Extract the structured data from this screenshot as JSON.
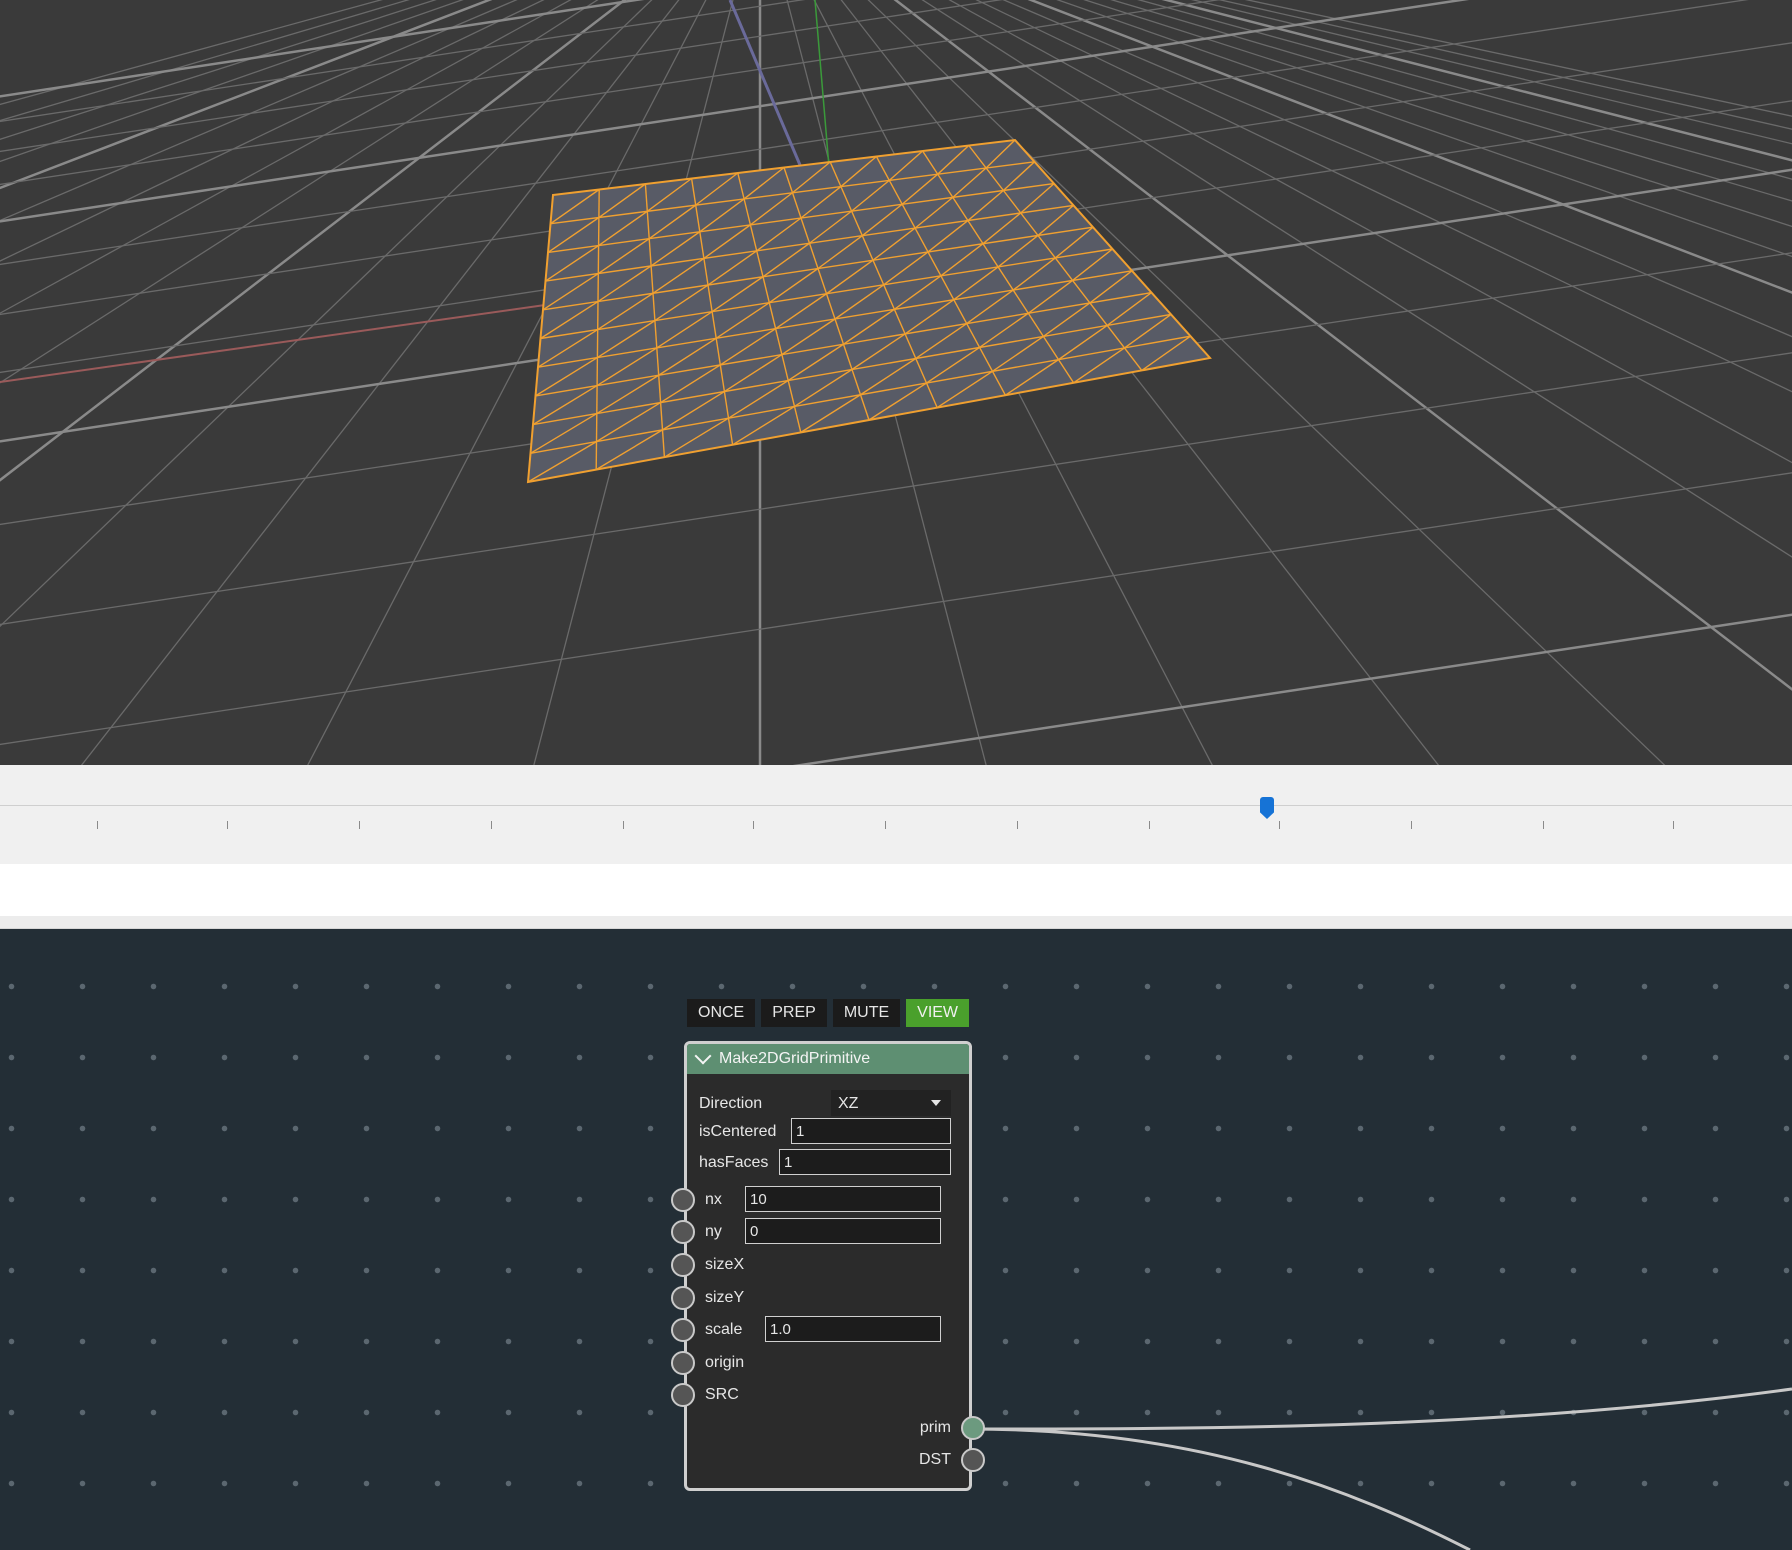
{
  "node": {
    "title": "Make2DGridPrimitive",
    "flags": [
      "ONCE",
      "PREP",
      "MUTE",
      "VIEW"
    ],
    "active_flag": "VIEW",
    "params": {
      "direction_label": "Direction",
      "direction_value": "XZ",
      "isCentered_label": "isCentered",
      "isCentered_value": "1",
      "hasFaces_label": "hasFaces",
      "hasFaces_value": "1"
    },
    "inputs": {
      "nx_label": "nx",
      "nx_value": "10",
      "ny_label": "ny",
      "ny_value": "0",
      "sizeX_label": "sizeX",
      "sizeY_label": "sizeY",
      "scale_label": "scale",
      "scale_value": "1.0",
      "origin_label": "origin",
      "SRC_label": "SRC"
    },
    "outputs": {
      "prim_label": "prim",
      "DST_label": "DST"
    }
  },
  "viewport": {
    "mesh_color": "#f0a030",
    "mesh_fill": "#585b66",
    "grid_line_color": "#7a7a7a",
    "x_axis_color": "#a05a5a",
    "y_axis_color": "#3a9a3a",
    "z_axis_color": "#5a5aa0"
  },
  "timeline": {
    "thumb_color": "#1673d6"
  }
}
